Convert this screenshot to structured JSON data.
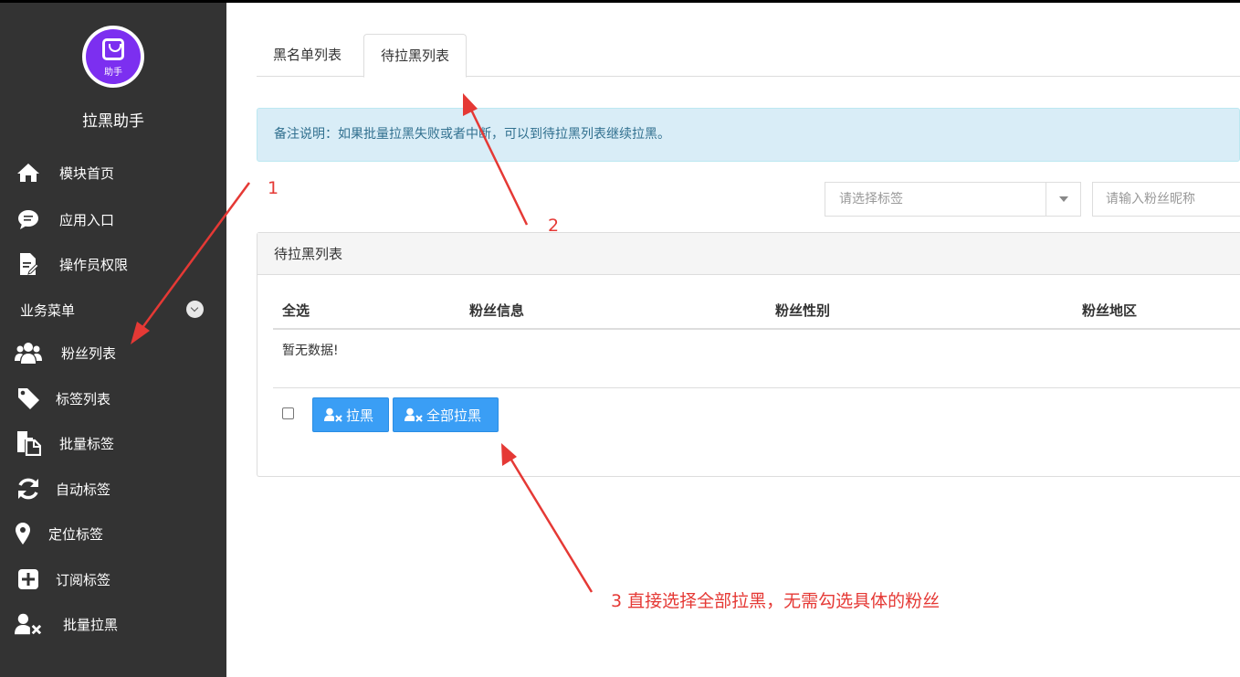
{
  "app": {
    "title": "拉黑助手",
    "logo_text": "助手"
  },
  "sidebar": {
    "items_top": [
      {
        "label": "模块首页",
        "icon": "home-icon"
      },
      {
        "label": "应用入口",
        "icon": "chat-bubble-icon"
      },
      {
        "label": "操作员权限",
        "icon": "document-edit-icon"
      }
    ],
    "section_title": "业务菜单",
    "items": [
      {
        "label": "粉丝列表",
        "icon": "users-icon"
      },
      {
        "label": "标签列表",
        "icon": "tag-icon"
      },
      {
        "label": "批量标签",
        "icon": "copy-icon"
      },
      {
        "label": "自动标签",
        "icon": "refresh-icon"
      },
      {
        "label": "定位标签",
        "icon": "map-pin-icon"
      },
      {
        "label": "订阅标签",
        "icon": "plus-square-icon"
      },
      {
        "label": "批量拉黑",
        "icon": "user-remove-icon"
      }
    ]
  },
  "tabs": [
    {
      "label": "黑名单列表",
      "active": false
    },
    {
      "label": "待拉黑列表",
      "active": true
    }
  ],
  "alert": {
    "text": "备注说明：如果批量拉黑失败或者中断，可以到待拉黑列表继续拉黑。"
  },
  "filters": {
    "tag_select_placeholder": "请选择标签",
    "nickname_placeholder": "请输入粉丝昵称"
  },
  "panel": {
    "title": "待拉黑列表",
    "columns": [
      "全选",
      "粉丝信息",
      "粉丝性别",
      "粉丝地区"
    ],
    "empty_text": "暂无数据!",
    "buttons": {
      "block": "拉黑",
      "block_all": "全部拉黑"
    }
  },
  "annotations": {
    "a1": "1",
    "a2": "2",
    "a3": "3 直接选择全部拉黑，无需勾选具体的粉丝"
  },
  "colors": {
    "sidebar_bg": "#333333",
    "accent_button": "#3a9ef5",
    "alert_bg": "#d9edf7",
    "annotation": "#e53935",
    "logo_purple": "#7c2ff0"
  }
}
